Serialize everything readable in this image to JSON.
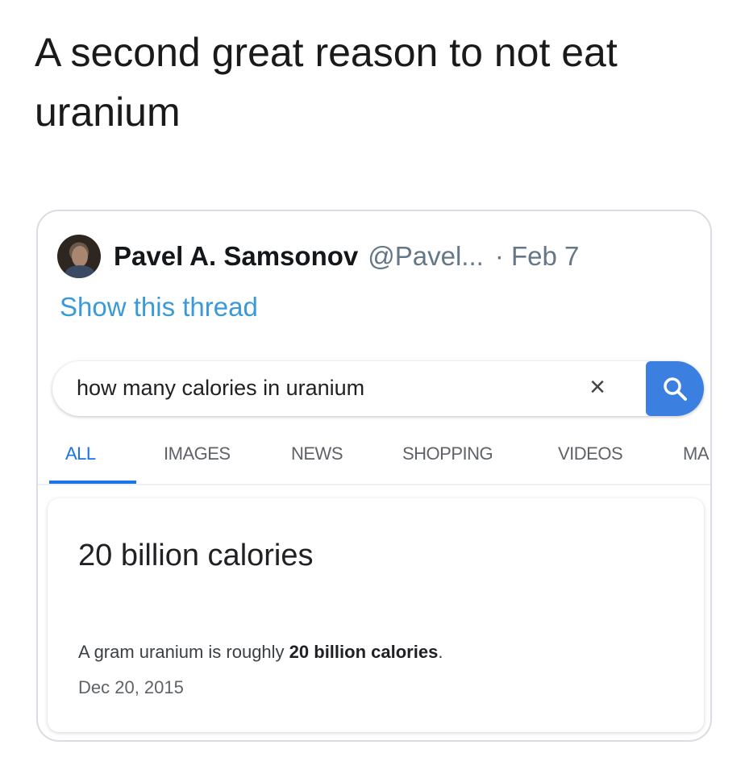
{
  "caption": "A second great reason to not eat uranium",
  "tweet": {
    "author_name": "Pavel A. Samsonov",
    "author_handle": "@Pavel...",
    "date": "· Feb 7",
    "show_thread": "Show this thread"
  },
  "search": {
    "query": "how many calories in uranium",
    "clear_label": "×",
    "accent_color": "#3b7fe0"
  },
  "tabs": [
    {
      "label": "ALL",
      "active": true
    },
    {
      "label": "IMAGES",
      "active": false
    },
    {
      "label": "NEWS",
      "active": false
    },
    {
      "label": "SHOPPING",
      "active": false
    },
    {
      "label": "VIDEOS",
      "active": false
    },
    {
      "label": "MA",
      "active": false
    }
  ],
  "answer": {
    "headline": "20 billion calories",
    "snippet_prefix": "A gram uranium is roughly ",
    "snippet_bold": "20 billion calories",
    "snippet_suffix": ".",
    "date": "Dec 20, 2015"
  },
  "icons": {
    "search": "search-icon",
    "clear": "close-icon",
    "avatar": "avatar"
  }
}
